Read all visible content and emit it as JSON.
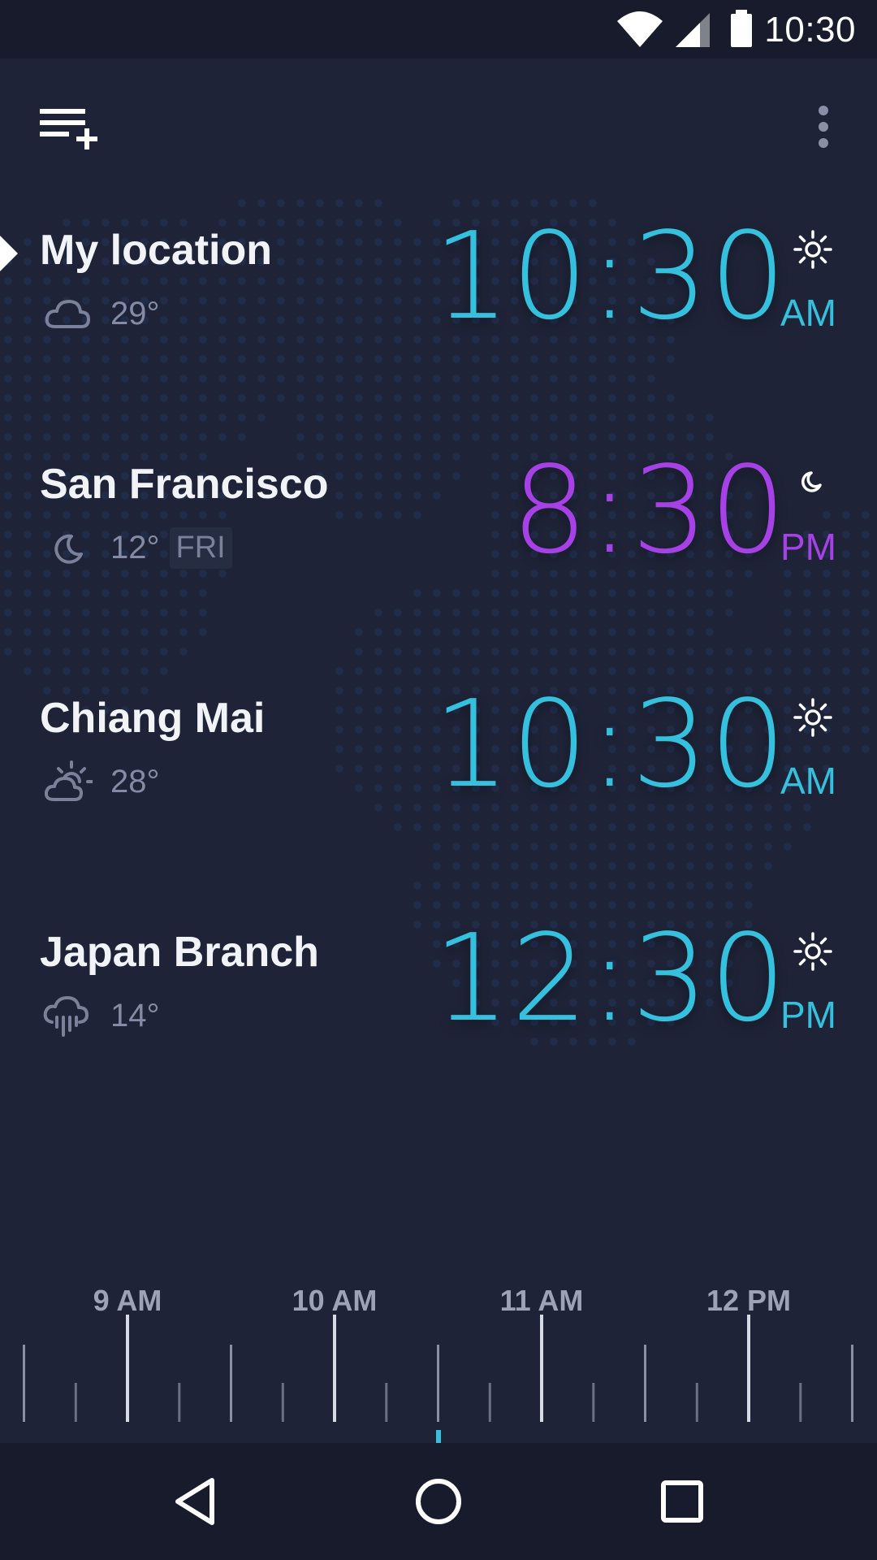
{
  "status_bar": {
    "time": "10:30",
    "icons": [
      "wifi-icon",
      "cellular-signal-icon",
      "battery-icon"
    ]
  },
  "toolbar": {
    "add_city_icon": "playlist-add-icon",
    "menu_icon": "more-vert-icon"
  },
  "cities": [
    {
      "name": "My location",
      "weather_icon": "cloud-icon",
      "temperature": "29°",
      "day": "",
      "time": "10:30",
      "ampm": "AM",
      "time_of_day_icon": "sun-icon",
      "color": "#35c0de",
      "selected": true
    },
    {
      "name": "San Francisco",
      "weather_icon": "moon-icon",
      "temperature": "12°",
      "day": "FRI",
      "time": "8:30",
      "ampm": "PM",
      "time_of_day_icon": "moon-icon",
      "color": "#a641e6",
      "selected": false
    },
    {
      "name": "Chiang Mai",
      "weather_icon": "partly-cloudy-icon",
      "temperature": "28°",
      "day": "",
      "time": "10:30",
      "ampm": "AM",
      "time_of_day_icon": "sun-icon",
      "color": "#35c0de",
      "selected": false
    },
    {
      "name": "Japan Branch",
      "weather_icon": "rain-icon",
      "temperature": "14°",
      "day": "",
      "time": "12:30",
      "ampm": "PM",
      "time_of_day_icon": "sun-icon",
      "color": "#35c0de",
      "selected": false
    }
  ],
  "timeline": {
    "labels": [
      "9 AM",
      "10 AM",
      "11 AM",
      "12 PM"
    ],
    "current_marker_color": "#35c0de"
  },
  "nav_bar": {
    "icons": [
      "back-icon",
      "home-icon",
      "recents-icon"
    ]
  }
}
